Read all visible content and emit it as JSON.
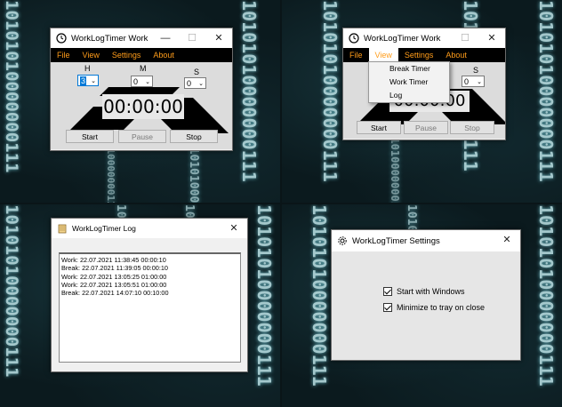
{
  "timer_window": {
    "title": "WorkLogTimer Work",
    "menu": [
      "File",
      "View",
      "Settings",
      "About"
    ],
    "labels": {
      "h": "H",
      "m": "M",
      "s": "S"
    },
    "h_value": "3",
    "m_value": "0",
    "s_value": "0",
    "clock": "00:00:00",
    "start": "Start",
    "pause": "Pause",
    "stop": "Stop"
  },
  "timer_window_view": {
    "title": "WorkLogTimer Work",
    "menu": [
      "File",
      "View",
      "Settings",
      "About"
    ],
    "active_menu": "View",
    "dropdown": [
      "Break Timer",
      "Work Timer",
      "Log"
    ],
    "s_label": "S",
    "s_value": "0",
    "clock": "00:00:00",
    "start": "Start",
    "pause": "Pause",
    "stop": "Stop"
  },
  "log_window": {
    "title": "WorkLogTimer Log",
    "entries": [
      "Work: 22.07.2021 11:38:45 00:00:10",
      "Break: 22.07.2021 11:39:05 00:00:10",
      "Work: 22.07.2021 13:05:25 01:00:00",
      "Work: 22.07.2021 13:05:51 01:00:00",
      "Break: 22.07.2021 14:07:10 00:10:00"
    ]
  },
  "settings_window": {
    "title": "WorkLogTimer Settings",
    "options": [
      {
        "label": "Start with Windows",
        "checked": true
      },
      {
        "label": "Minimize to tray on close",
        "checked": true
      }
    ]
  },
  "background": {
    "binary": [
      "10101010000000111",
      "101010000000111",
      "1010101000000111",
      "10101010000000111"
    ]
  },
  "colors": {
    "menu_bg": "#000000",
    "menu_text": "#ff9c1a",
    "bg": "#0b1a1e"
  },
  "window_controls": {
    "minimize": "—",
    "maximize": "☐",
    "close": "✕"
  }
}
